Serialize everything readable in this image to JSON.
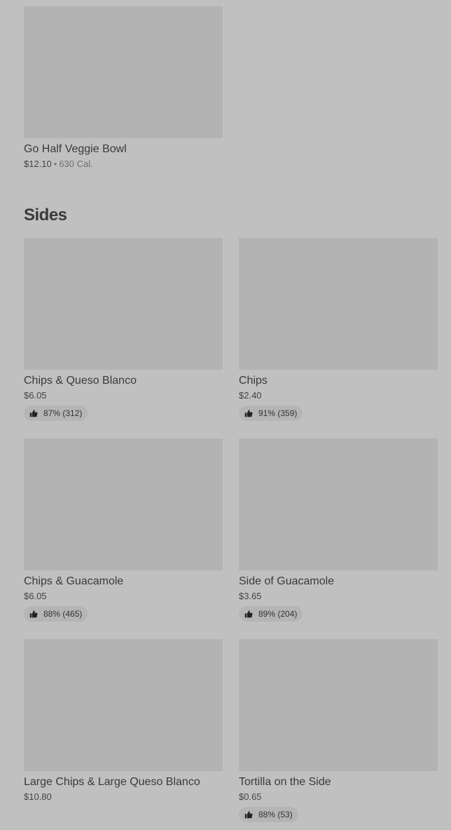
{
  "top_item": {
    "name": "Go Half Veggie Bowl",
    "price": "$12.10",
    "separator": "•",
    "calories": "630 Cal."
  },
  "sides": {
    "title": "Sides",
    "items": [
      {
        "name": "Chips & Queso Blanco",
        "price": "$6.05",
        "rating": "87% (312)"
      },
      {
        "name": "Chips",
        "price": "$2.40",
        "rating": "91% (359)"
      },
      {
        "name": "Chips & Guacamole",
        "price": "$6.05",
        "rating": "88% (465)"
      },
      {
        "name": "Side of Guacamole",
        "price": "$3.65",
        "rating": "89% (204)"
      },
      {
        "name": "Large Chips & Large Queso Blanco",
        "price": "$10.80",
        "rating": ""
      },
      {
        "name": "Tortilla on the Side",
        "price": "$0.65",
        "rating": "88% (53)"
      }
    ]
  },
  "icons": {
    "rating": "thumbs-up-icon"
  },
  "colors": {
    "background": "#c0c0c0",
    "image_placeholder": "#b3b3b3",
    "rating_pill": "#b5b5b5",
    "text": "#3a3a3a"
  }
}
